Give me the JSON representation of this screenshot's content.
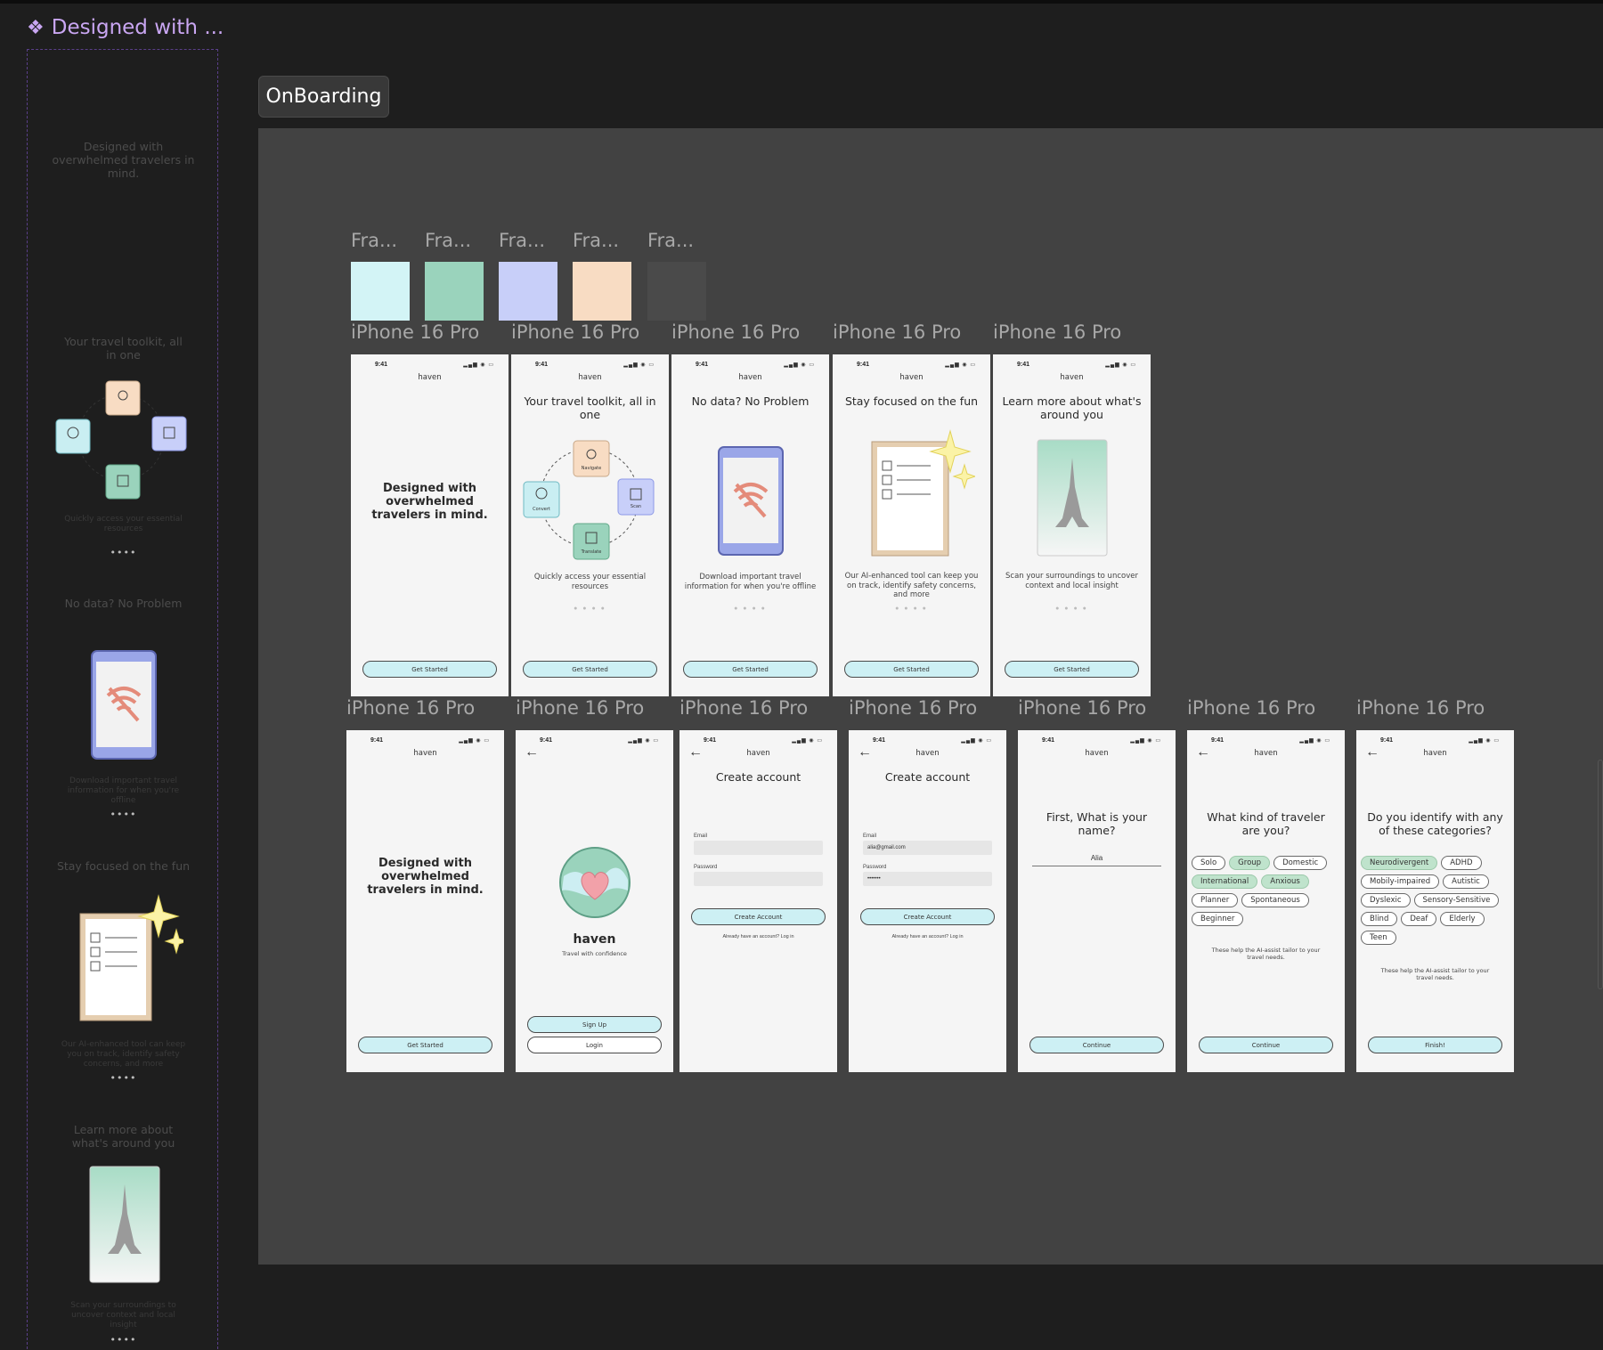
{
  "component_set": {
    "title": "Designed with ...",
    "icon": "component-diamond-icon"
  },
  "sidebar": {
    "s1": {
      "heading": "Designed with overwhelmed travelers in mind."
    },
    "s2": {
      "heading": "Your travel toolkit, all in one",
      "body": "Quickly access your essential resources",
      "dots": "••••"
    },
    "s3": {
      "heading": "No data? No Problem",
      "body": "Download important travel information for when you're offline",
      "dots": "••••"
    },
    "s4": {
      "heading": "Stay focused on the fun",
      "body": "Our AI-enhanced tool can keep you on track, identify safety concerns, and more",
      "dots": "••••"
    },
    "s5": {
      "heading": "Learn more about what's around you",
      "body": "Scan your surroundings to uncover context and local insight",
      "dots": "••••"
    }
  },
  "section": {
    "label": "OnBoarding"
  },
  "swatches": [
    {
      "label": "Fra...",
      "color": "#d3f4f6"
    },
    {
      "label": "Fra...",
      "color": "#9ad3bc"
    },
    {
      "label": "Fra...",
      "color": "#c8cff9"
    },
    {
      "label": "Fra...",
      "color": "#f8dcc3"
    },
    {
      "label": "Fra...",
      "color": "#4a4a4a"
    }
  ],
  "frame_label": "iPhone 16 Pro",
  "toolkit_icons": {
    "navigate": "Navigate",
    "convert": "Convert",
    "scan": "Scan",
    "translate": "Translate"
  },
  "phone": {
    "time": "9:41",
    "brand": "haven",
    "signal": "▂▄▆ ◉ ▭"
  },
  "row1": [
    {
      "heading": "Designed with overwhelmed travelers in mind.",
      "button": "Get Started"
    },
    {
      "heading": "Your travel toolkit, all in one",
      "body": "Quickly access your essential resources",
      "dots": "● ● ● ●",
      "button": "Get Started"
    },
    {
      "heading": "No data? No Problem",
      "body": "Download important travel information for when you're offline",
      "dots": "● ● ● ●",
      "button": "Get Started"
    },
    {
      "heading": "Stay focused on the fun",
      "body": "Our AI-enhanced tool can keep you on track, identify safety concerns, and more",
      "dots": "● ● ● ●",
      "button": "Get Started"
    },
    {
      "heading": "Learn more about what's around you",
      "body": "Scan your surroundings to uncover context and local insight",
      "dots": "● ● ● ●",
      "button": "Get Started"
    }
  ],
  "row2": {
    "welcome": {
      "heading": "Designed with overwhelmed travelers in mind.",
      "button": "Get Started"
    },
    "splash": {
      "name": "haven",
      "tagline": "Travel with confidence",
      "signup": "Sign Up",
      "login": "Login"
    },
    "create_empty": {
      "title": "Create account",
      "email_label": "Email",
      "password_label": "Password",
      "button": "Create Account",
      "footer": "Already have an account? Log in"
    },
    "create_filled": {
      "title": "Create account",
      "email_label": "Email",
      "email_value": "alia@gmail.com",
      "password_label": "Password",
      "password_value": "•••••••",
      "button": "Create Account",
      "footer": "Already have an account? Log in"
    },
    "name": {
      "heading": "First, What is your name?",
      "value": "Alia",
      "button": "Continue"
    },
    "traveler": {
      "heading": "What kind of traveler are you?",
      "chips": [
        {
          "label": "Solo",
          "selected": false
        },
        {
          "label": "Group",
          "selected": true
        },
        {
          "label": "Domestic",
          "selected": false
        },
        {
          "label": "International",
          "selected": true
        },
        {
          "label": "Anxious",
          "selected": true
        },
        {
          "label": "Planner",
          "selected": false
        },
        {
          "label": "Spontaneous",
          "selected": false
        },
        {
          "label": "Beginner",
          "selected": false
        }
      ],
      "note": "These help the AI-assist tailor to your travel needs.",
      "button": "Continue"
    },
    "categories": {
      "heading": "Do you identify with any of these categories?",
      "chips": [
        {
          "label": "Neurodivergent",
          "selected": true
        },
        {
          "label": "ADHD",
          "selected": false
        },
        {
          "label": "Mobily-impaired",
          "selected": false
        },
        {
          "label": "Autistic",
          "selected": false
        },
        {
          "label": "Dyslexic",
          "selected": false
        },
        {
          "label": "Sensory-Sensitive",
          "selected": false
        },
        {
          "label": "Blind",
          "selected": false
        },
        {
          "label": "Deaf",
          "selected": false
        },
        {
          "label": "Elderly",
          "selected": false
        },
        {
          "label": "Teen",
          "selected": false
        }
      ],
      "note": "These help the AI-assist tailor to your travel needs.",
      "button": "Finish!"
    }
  }
}
